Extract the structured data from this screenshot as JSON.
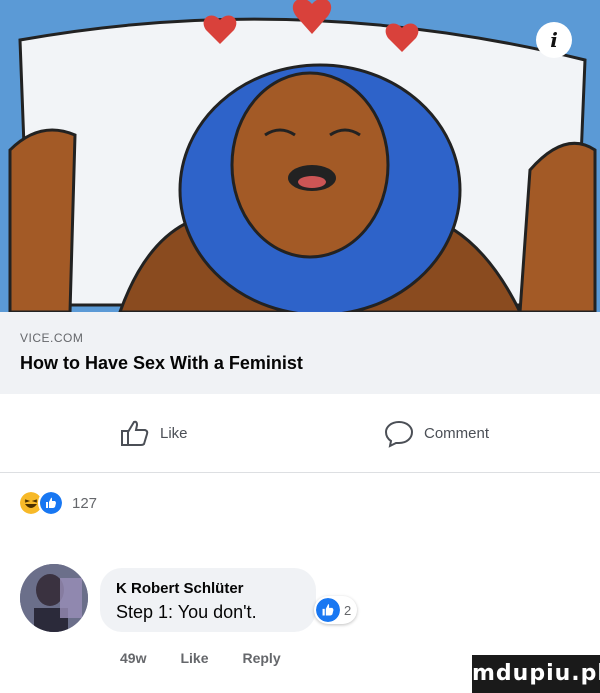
{
  "post": {
    "info_icon_label": "i",
    "link": {
      "domain": "VICE.COM",
      "title": "How to Have Sex With a Feminist"
    },
    "actions": {
      "like_label": "Like",
      "comment_label": "Comment"
    },
    "reactions": {
      "count": "127",
      "types": [
        "haha",
        "like"
      ]
    }
  },
  "comment": {
    "author": "K Robert Schlüter",
    "text": "Step 1: You don't.",
    "reaction_count": "2",
    "age": "49w",
    "like_label": "Like",
    "reply_label": "Reply"
  },
  "watermark": {
    "text": "mdupiu.pl"
  },
  "colors": {
    "image_bg": "#5b9ad6",
    "like_blue": "#1877f2",
    "haha_yellow": "#f7b928",
    "link_bg": "#f0f2f5"
  }
}
